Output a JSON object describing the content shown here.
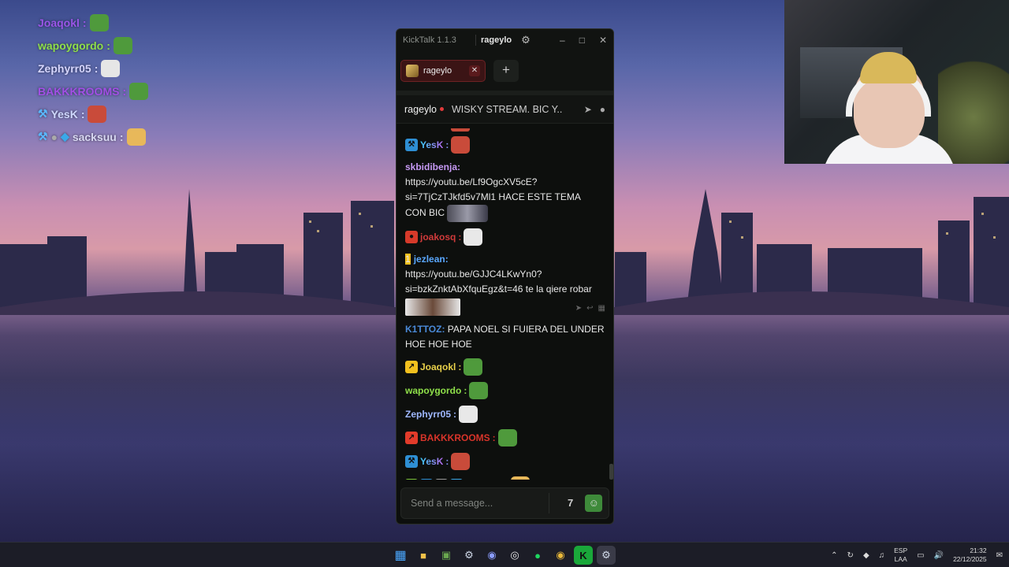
{
  "overlay": {
    "lines": [
      {
        "name": "Joaqokl",
        "color": "#9a55e8",
        "emote_color": "#4f9a3c",
        "badges": []
      },
      {
        "name": "wapoygordo",
        "color": "#8fe04a",
        "emote_color": "#4f9a3c",
        "badges": []
      },
      {
        "name": "Zephyrr05",
        "color": "#d6d6ff",
        "emote_color": "#e6e6e6",
        "badges": []
      },
      {
        "name": "BAKKKROOMS",
        "color": "#a24fe6",
        "emote_color": "#4f9a3c",
        "badges": []
      },
      {
        "name": "YesK",
        "color": "#cfd8ff",
        "emote_color": "#c94b3a",
        "badges": [
          "hammer"
        ]
      },
      {
        "name": "sacksuu",
        "color": "#d8d8f2",
        "emote_color": "#e8b85a",
        "badges": [
          "hammer",
          "gem",
          "cube"
        ]
      }
    ]
  },
  "window": {
    "app_title": "KickTalk 1.1.3",
    "user": "rageylo",
    "controls": [
      "–",
      "□",
      "✕"
    ]
  },
  "tabs": [
    {
      "label": "rageylo"
    }
  ],
  "channel": {
    "name": "rageylo",
    "title": "WISKY STREAM. BIC Y..."
  },
  "messages": [
    {
      "type": "simple",
      "badges": [
        {
          "bg": "#2e8fd4",
          "glyph": "⚒"
        }
      ],
      "user": "YesK",
      "user_color": "gradient-yesk",
      "emote": "#c94b3a"
    },
    {
      "type": "block",
      "user": "skbidibenja",
      "user_color": "#c79af5",
      "lines": [
        "https://youtu.be/Lf9OgcXV5cE?",
        "si=7TjCzTJkfd5v7Ml1",
        "HACE ESTE TEMA",
        "CON BIC"
      ]
    },
    {
      "type": "simple",
      "badges": [
        {
          "bg": "#d63a2a",
          "glyph": "●"
        }
      ],
      "user": "joakosq",
      "user_color": "#d03a3a",
      "emote": "#e8e8e8"
    },
    {
      "type": "block2",
      "badges": [
        {
          "bg": "#f2c01e",
          "glyph": "1"
        }
      ],
      "user": "jezlean",
      "user_color": "#5aa8ff",
      "lines": [
        "https://youtu.be/GJJC4LKwYn0?",
        "si=bzkZnktAbXfquEgz&t=46",
        "te la qiere robar"
      ]
    },
    {
      "type": "text",
      "user": "K1TTOZ",
      "user_color": "#4a8ad8",
      "text": "PAPA NOEL SI FUIERA DEL UNDER HOE HOE HOE"
    },
    {
      "type": "simple",
      "badges": [
        {
          "bg": "#f2c01e",
          "glyph": "↗"
        }
      ],
      "user": "Joaqokl",
      "user_color": "#e8d04a",
      "emote": "#4f9a3c"
    },
    {
      "type": "simple",
      "badges": [],
      "user": "wapoygordo",
      "user_color": "#8fe04a",
      "emote": "#4f9a3c"
    },
    {
      "type": "simple",
      "badges": [],
      "user": "Zephyrr05",
      "user_color": "#9fb8ff",
      "emote": "#e8e8e8"
    },
    {
      "type": "simple",
      "badges": [
        {
          "bg": "#e23b2a",
          "glyph": "↗"
        }
      ],
      "user": "BAKKKROOMS",
      "user_color": "#d8342a",
      "emote": "#4f9a3c"
    },
    {
      "type": "simple",
      "badges": [
        {
          "bg": "#2e8fd4",
          "glyph": "⚒"
        }
      ],
      "user": "YesK",
      "user_color": "gradient-yesk",
      "emote": "#c94b3a"
    },
    {
      "type": "simple",
      "badges": [
        {
          "bg": "#7cc43a",
          "glyph": "☺"
        },
        {
          "bg": "#2e8fd4",
          "glyph": "⚒"
        },
        {
          "bg": "#9a9a9a",
          "glyph": "●"
        },
        {
          "bg": "#3aa8e8",
          "glyph": "◆"
        }
      ],
      "user": "sacksuu",
      "user_color": "#e05a2a",
      "emote": "#e8b85a"
    }
  ],
  "input": {
    "placeholder": "Send a message..."
  },
  "taskbar": {
    "apps": [
      "windows-start",
      "file-explorer",
      "minecraft",
      "steam",
      "discord",
      "obs",
      "spotify",
      "chrome",
      "kick",
      "steam-active"
    ],
    "lang_top": "ESP",
    "lang_bottom": "LAA",
    "time": "21:32",
    "date": "22/12/2025"
  },
  "colors": {
    "accent_red": "#e23b3b",
    "kick_green": "#53fc18",
    "window_bg": "#0d0f0d"
  }
}
